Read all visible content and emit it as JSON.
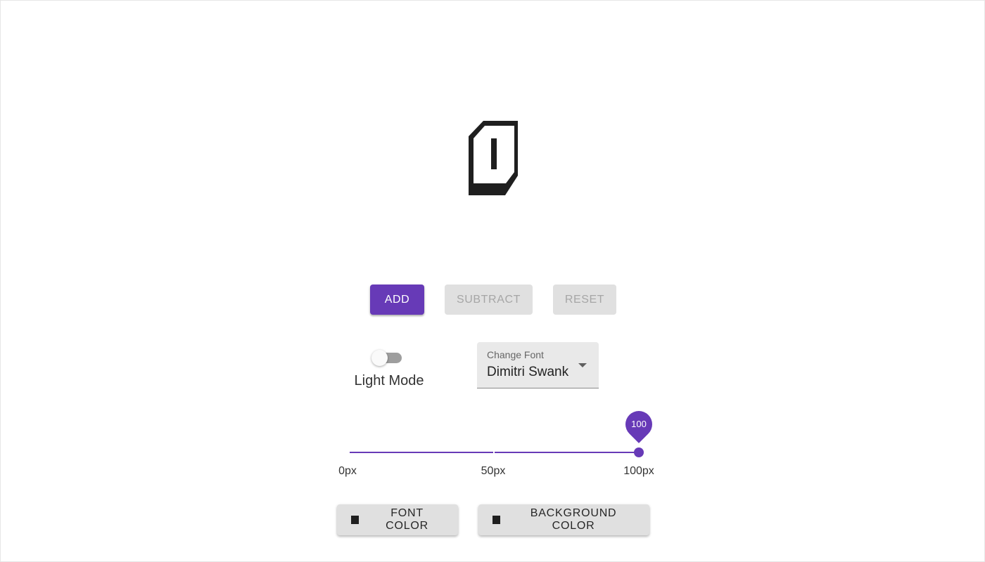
{
  "preview": {
    "glyph_icon": "pixel-i-glyph",
    "glyph_color": "#1f1f1f"
  },
  "actions": {
    "add_label": "ADD",
    "subtract_label": "SUBTRACT",
    "reset_label": "RESET",
    "accent_color": "#673ab7"
  },
  "theme_toggle": {
    "label": "Light Mode",
    "checked": false
  },
  "font_select": {
    "label": "Change Font",
    "value": "Dimitri Swank"
  },
  "size_slider": {
    "value": 100,
    "value_label": "100",
    "min": 0,
    "max": 100,
    "ticks": [
      "0px",
      "50px",
      "100px"
    ]
  },
  "color_buttons": {
    "font_color_label": "FONT COLOR",
    "font_color_value": "#1f1f1f",
    "background_color_label": "BACKGROUND COLOR",
    "background_color_value": "#1f1f1f"
  }
}
